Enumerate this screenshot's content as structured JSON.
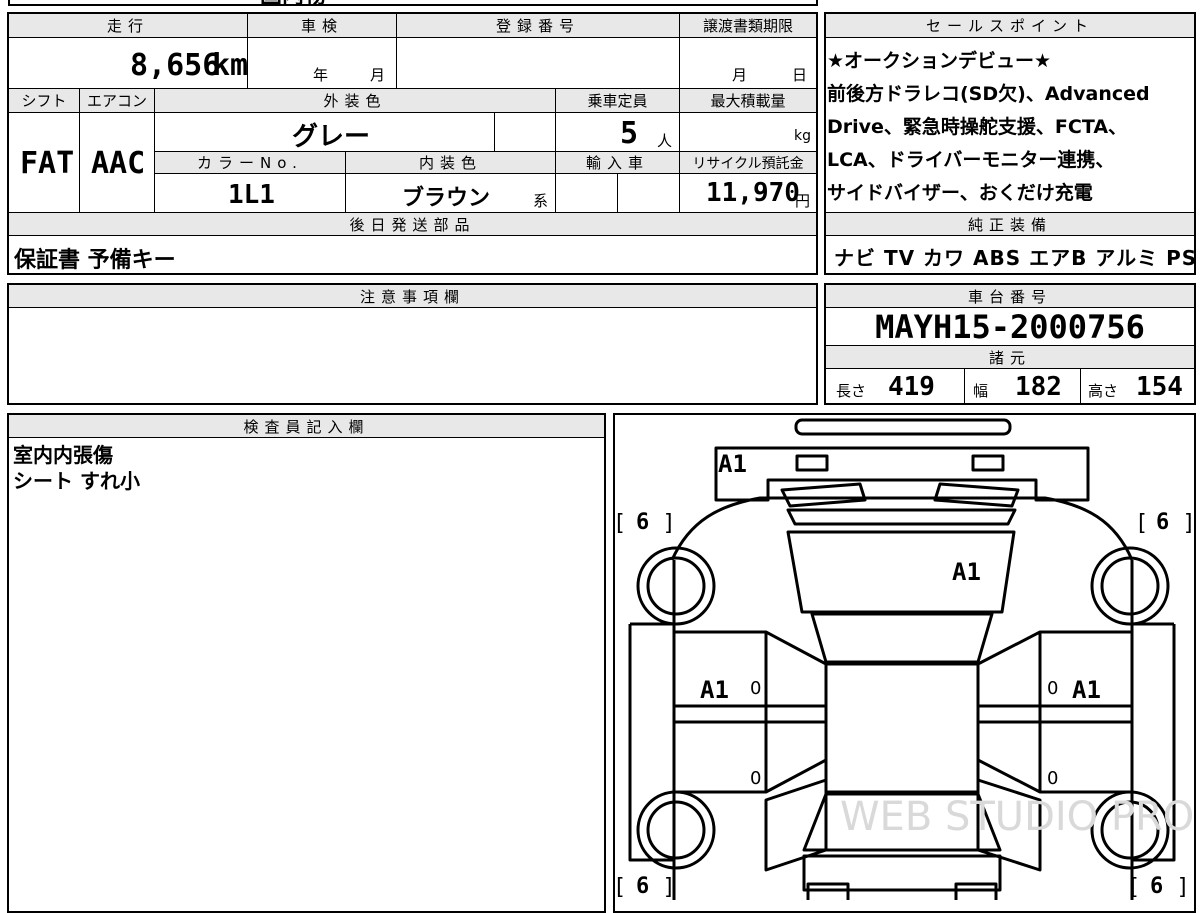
{
  "top_partial": "国内物",
  "headers": {
    "mileage": "走行",
    "inspection": "車検",
    "registration_no": "登録番号",
    "transfer_deadline": "譲渡書類期限",
    "sales_points": "セールスポイント",
    "shift": "シフト",
    "aircon": "エアコン",
    "exterior_color": "外装色",
    "capacity": "乗車定員",
    "max_load": "最大積載量",
    "color_no": "カラーNo.",
    "interior_color": "内装色",
    "import": "輸入車",
    "recycle_fee": "リサイクル預託金",
    "later_parts": "後日発送部品",
    "genuine_equipment": "純正装備",
    "notes": "注意事項欄",
    "chassis_no": "車台番号",
    "specs": "諸元",
    "inspector": "検査員記入欄"
  },
  "values": {
    "mileage": "8,656",
    "mileage_unit": "km",
    "inspection_year": "年",
    "inspection_month": "月",
    "deadline_month": "月",
    "deadline_day": "日",
    "shift": "FAT",
    "aircon": "AAC",
    "exterior_color": "グレー",
    "capacity": "5",
    "capacity_unit": "人",
    "max_load_unit": "kg",
    "color_no": "1L1",
    "interior_color": "ブラウン",
    "interior_suffix": "系",
    "recycle_fee": "11,970",
    "recycle_unit": "円",
    "later_parts": "保証書 予備キー",
    "chassis_no": "MAYH15-2000756",
    "length_label": "長さ",
    "length": "419",
    "width_label": "幅",
    "width": "182",
    "height_label": "高さ",
    "height": "154"
  },
  "sales_points_lines": [
    "★オークションデビュー★",
    "前後方ドラレコ(SD欠)、Advanced",
    "Drive、緊急時操舵支援、FCTA、",
    "LCA、ドライバーモニター連携、",
    "サイドバイザー、おくだけ充電"
  ],
  "equipment": "ナビ TV カワ ABS エアB アルミ PS PW",
  "inspector_lines": [
    "室内内張傷",
    "シート すれ小"
  ],
  "diagram": {
    "marks": {
      "rear": "A1",
      "hood": "A1",
      "left_door": "A1",
      "right_door": "A1",
      "tread_fl": "6",
      "tread_fr": "6",
      "tread_rl": "6",
      "tread_rr": "6",
      "zero": "0"
    },
    "watermark": "WEB STUDIO PRO"
  }
}
